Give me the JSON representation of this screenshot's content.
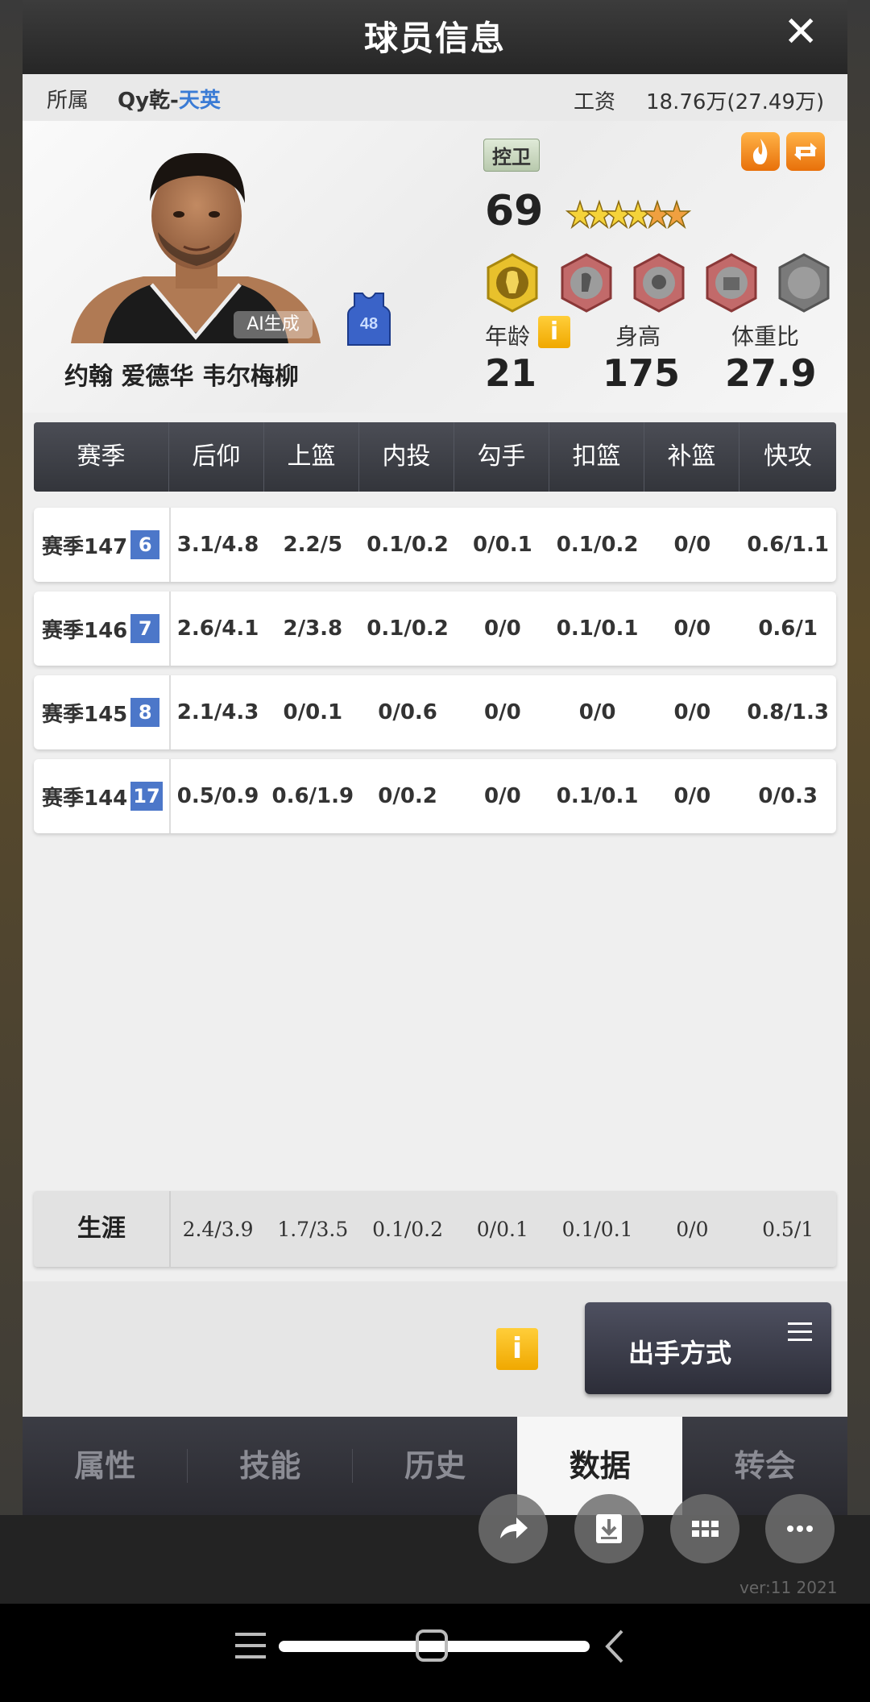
{
  "header": {
    "title": "球员信息",
    "close_label": "✕"
  },
  "infobar": {
    "affiliation_label": "所属",
    "club_main": "Qy乾-",
    "club_sub": "天英",
    "wage_label": "工资",
    "wage_value": "18.76万(27.49万)"
  },
  "player": {
    "name": "约翰 爱德华 韦尔梅柳",
    "ai_label": "AI生成",
    "jersey_number": "48",
    "position": "控卫",
    "overall": "69",
    "age_label": "年龄",
    "age": "21",
    "height_label": "身高",
    "height": "175",
    "weight_label": "体重比",
    "weight_ratio": "27.9",
    "info_icon": "i"
  },
  "table": {
    "headers": [
      "赛季",
      "后仰",
      "上篮",
      "内投",
      "勾手",
      "扣篮",
      "补篮",
      "快攻"
    ],
    "rows": [
      {
        "season": "赛季147",
        "rank": "6",
        "values": [
          "3.1/4.8",
          "2.2/5",
          "0.1/0.2",
          "0/0.1",
          "0.1/0.2",
          "0/0",
          "0.6/1.1"
        ]
      },
      {
        "season": "赛季146",
        "rank": "7",
        "values": [
          "2.6/4.1",
          "2/3.8",
          "0.1/0.2",
          "0/0",
          "0.1/0.1",
          "0/0",
          "0.6/1"
        ]
      },
      {
        "season": "赛季145",
        "rank": "8",
        "values": [
          "2.1/4.3",
          "0/0.1",
          "0/0.6",
          "0/0",
          "0/0",
          "0/0",
          "0.8/1.3"
        ]
      },
      {
        "season": "赛季144",
        "rank": "17",
        "values": [
          "0.5/0.9",
          "0.6/1.9",
          "0/0.2",
          "0/0",
          "0.1/0.1",
          "0/0",
          "0/0.3"
        ]
      }
    ],
    "career": {
      "label": "生涯",
      "values": [
        "2.4/3.9",
        "1.7/3.5",
        "0.1/0.2",
        "0/0.1",
        "0.1/0.1",
        "0/0",
        "0.5/1"
      ]
    }
  },
  "footer": {
    "info_icon": "i",
    "shot_button_label": "出手方式"
  },
  "tabs": [
    "属性",
    "技能",
    "历史",
    "数据",
    "转会"
  ],
  "active_tab": "数据",
  "background": {
    "version": "ver:11  2021"
  },
  "colors": {
    "accent_blue": "#4c77c9",
    "info_yellow": "#f0a800",
    "club_sub": "#3a7bd5"
  }
}
